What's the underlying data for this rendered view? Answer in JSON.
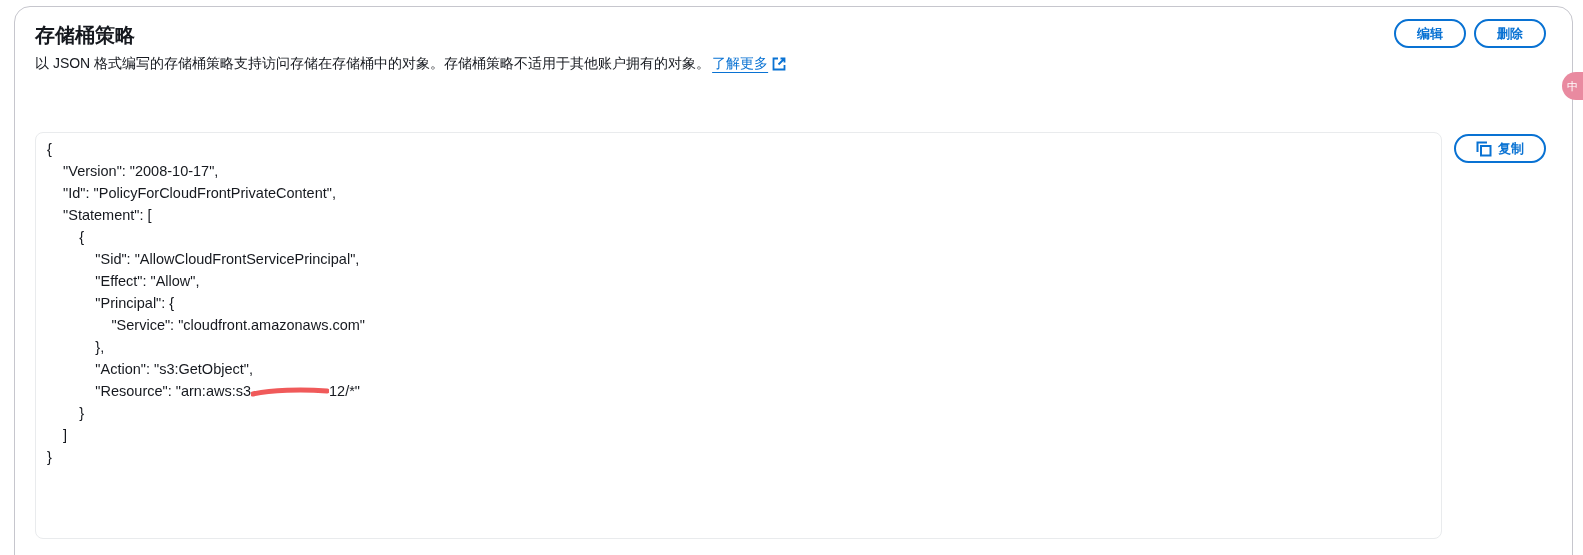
{
  "header": {
    "title": "存储桶策略",
    "description": "以 JSON 格式编写的存储桶策略支持访问存储在存储桶中的对象。存储桶策略不适用于其他账户拥有的对象。",
    "learn_more": "了解更多"
  },
  "actions": [
    "编辑",
    "删除"
  ],
  "copy_button": "复制",
  "ime_badge": "中",
  "code_lines": [
    {
      "text": "{"
    },
    {
      "text": "    \"Version\": \"2008-10-17\","
    },
    {
      "text": "    \"Id\": \"PolicyForCloudFrontPrivateContent\","
    },
    {
      "text": "    \"Statement\": ["
    },
    {
      "text": "        {"
    },
    {
      "text": "            \"Sid\": \"AllowCloudFrontServicePrincipal\","
    },
    {
      "text": "            \"Effect\": \"Allow\","
    },
    {
      "text": "            \"Principal\": {"
    },
    {
      "text": "                \"Service\": \"cloudfront.amazonaws.com\""
    },
    {
      "text": "            },"
    },
    {
      "text": "            \"Action\": \"s3:GetObject\","
    },
    {
      "text": "            \"Resource\": \"arn:aws:s3",
      "redacted": true,
      "tail": "12/*\""
    },
    {
      "text": "        }"
    },
    {
      "text": "    ]"
    },
    {
      "text": "}"
    }
  ]
}
